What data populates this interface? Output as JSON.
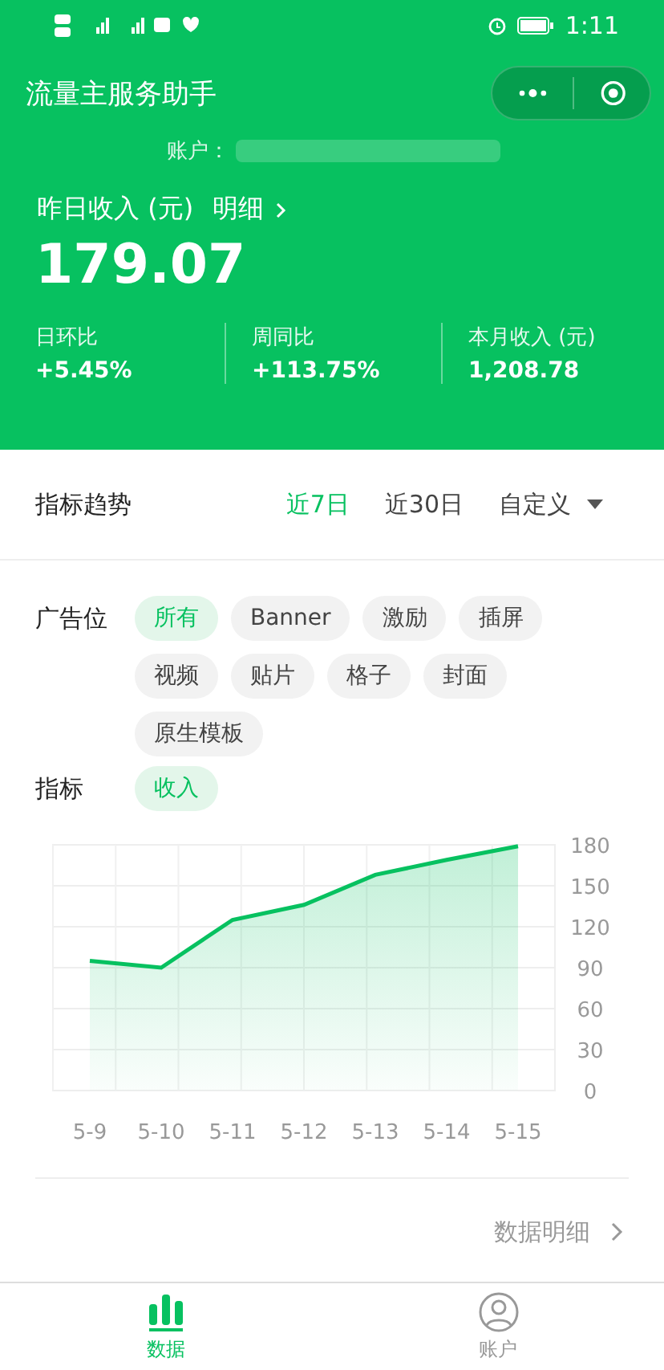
{
  "status_bar": {
    "time": "1:11"
  },
  "header": {
    "title": "流量主服务助手",
    "account_label": "账户：",
    "income_label": "昨日收入 (元)",
    "detail_link": "明细",
    "income_value": "179.07",
    "stats": [
      {
        "label": "日环比",
        "value": "+5.45%"
      },
      {
        "label": "周同比",
        "value": "+113.75%"
      },
      {
        "label": "本月收入 (元)",
        "value": "1,208.78"
      }
    ]
  },
  "trend": {
    "title": "指标趋势",
    "ranges": [
      {
        "label": "近7日",
        "selected": true
      },
      {
        "label": "近30日",
        "selected": false
      }
    ],
    "custom": "自定义"
  },
  "filters": [
    {
      "label": "广告位",
      "options": [
        {
          "label": "所有",
          "selected": true
        },
        {
          "label": "Banner",
          "selected": false
        },
        {
          "label": "激励",
          "selected": false
        },
        {
          "label": "插屏",
          "selected": false
        },
        {
          "label": "视频",
          "selected": false
        },
        {
          "label": "贴片",
          "selected": false
        },
        {
          "label": "格子",
          "selected": false
        },
        {
          "label": "封面",
          "selected": false
        },
        {
          "label": "原生模板",
          "selected": false
        }
      ]
    },
    {
      "label": "指标",
      "options": [
        {
          "label": "收入",
          "selected": true
        }
      ]
    }
  ],
  "chart_data": {
    "type": "area",
    "categories": [
      "5-9",
      "5-10",
      "5-11",
      "5-12",
      "5-13",
      "5-14",
      "5-15"
    ],
    "series": [
      {
        "color": "#07c160",
        "values": [
          95,
          90,
          125,
          136,
          158,
          169,
          179
        ]
      }
    ],
    "grid": true,
    "ylim": [
      0,
      180
    ],
    "yticks": [
      0,
      30,
      60,
      90,
      120,
      150,
      180
    ]
  },
  "detail_link": "数据明细",
  "tab_bar": [
    {
      "label": "数据",
      "kind": "chart",
      "selected": true
    },
    {
      "label": "账户",
      "kind": "user",
      "selected": false
    }
  ]
}
